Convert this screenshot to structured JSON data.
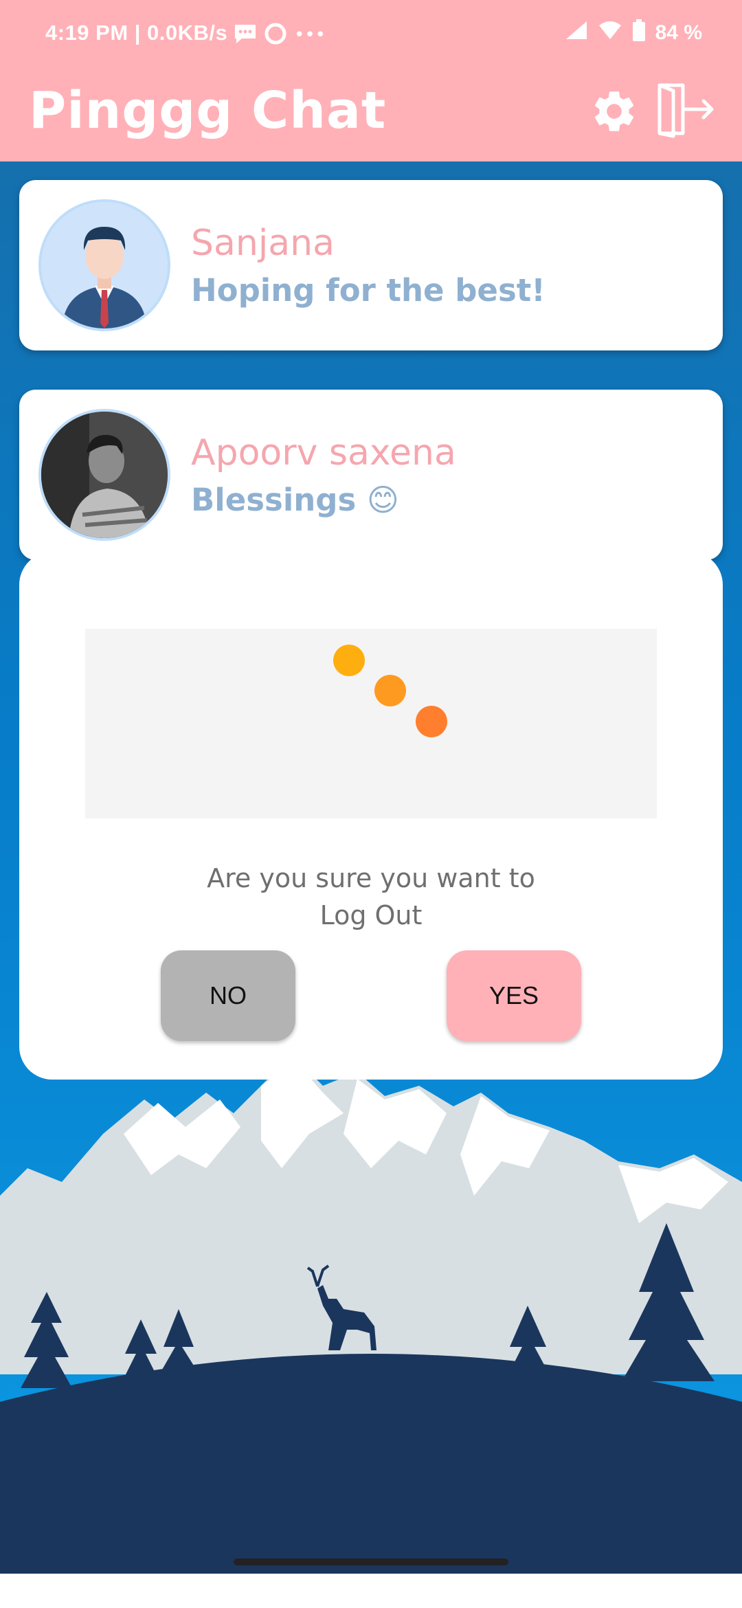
{
  "status_bar": {
    "time": "4:19 PM | 0.0KB/s",
    "battery": "84 %"
  },
  "app_bar": {
    "title": "Pinggg Chat",
    "icons": [
      "gear-icon",
      "logout-icon"
    ]
  },
  "chats": [
    {
      "name": "Sanjana",
      "status": "Hoping for the best!"
    },
    {
      "name": "Apoorv saxena",
      "status": "Blessings 😊"
    }
  ],
  "dialog": {
    "message_line1": "Are you sure you want to",
    "message_line2": "Log Out",
    "no_label": "NO",
    "yes_label": "YES"
  },
  "colors": {
    "accent_pink": "#FFB1B7",
    "name_pink": "#F5A6AE",
    "status_blue": "#8FB0D0",
    "sky_blue": "#0A86D6",
    "ground_navy": "#1B365C",
    "no_button": "#B3B3B3",
    "loader_dots": [
      "#FFAE0F",
      "#FF9A20",
      "#FF7F2E"
    ]
  }
}
